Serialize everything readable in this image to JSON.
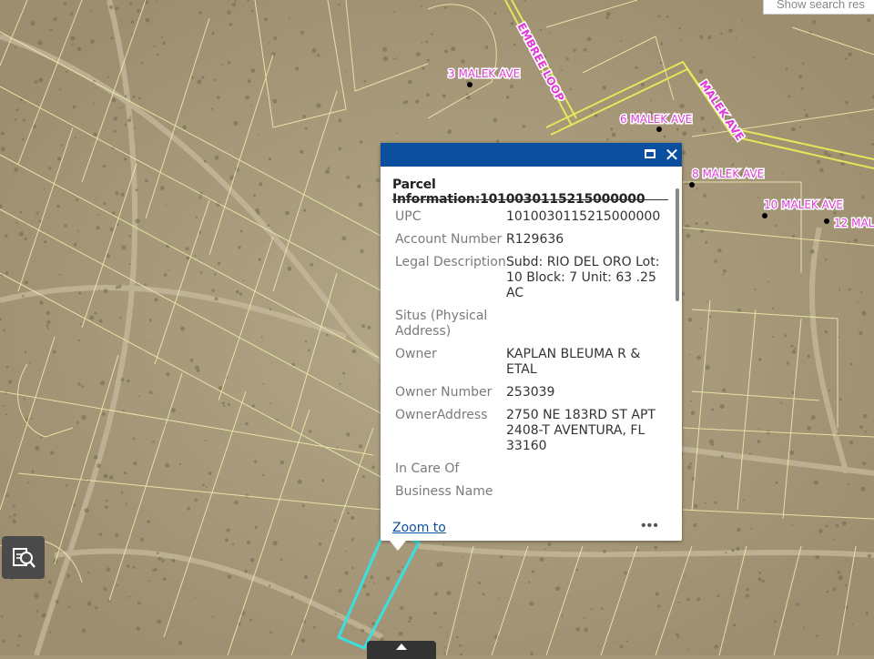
{
  "search": {
    "placeholder": "Show search res"
  },
  "map": {
    "streets": [
      {
        "id": "embree",
        "label": "EMBREE LOOP"
      },
      {
        "id": "malek",
        "label": "MALEK AVE"
      }
    ],
    "addresses": [
      {
        "id": "a3",
        "label": "3 MALEK AVE"
      },
      {
        "id": "a6",
        "label": "6 MALEK AVE"
      },
      {
        "id": "a8",
        "label": "8 MALEK AVE"
      },
      {
        "id": "a10",
        "label": "10 MALEK AVE"
      },
      {
        "id": "a12",
        "label": "12 MAL"
      }
    ],
    "colors": {
      "parcel_lines": "#f3efb0",
      "road": "#e6e65a",
      "selected_parcel": "#39e0e0",
      "label": "#e23ad8"
    }
  },
  "popup": {
    "title": "Parcel Information:1010030115215000000",
    "fields": [
      {
        "key": "UPC",
        "value": "1010030115215000000"
      },
      {
        "key": "Account Number",
        "value": "R129636"
      },
      {
        "key": "Legal Description",
        "value": "Subd: RIO DEL ORO Lot: 10 Block: 7 Unit: 63 .25 AC"
      },
      {
        "key": "Situs (Physical Address)",
        "value": ""
      },
      {
        "key": "Owner",
        "value": "KAPLAN BLEUMA R & ETAL"
      },
      {
        "key": "Owner Number",
        "value": "253039"
      },
      {
        "key": "OwnerAddress",
        "value": "2750 NE 183RD ST APT 2408-T AVENTURA, FL 33160"
      },
      {
        "key": "In Care Of",
        "value": ""
      },
      {
        "key": "Business Name",
        "value": ""
      }
    ],
    "zoom_label": "Zoom to",
    "more_label": "•••",
    "close_label": "✕"
  }
}
